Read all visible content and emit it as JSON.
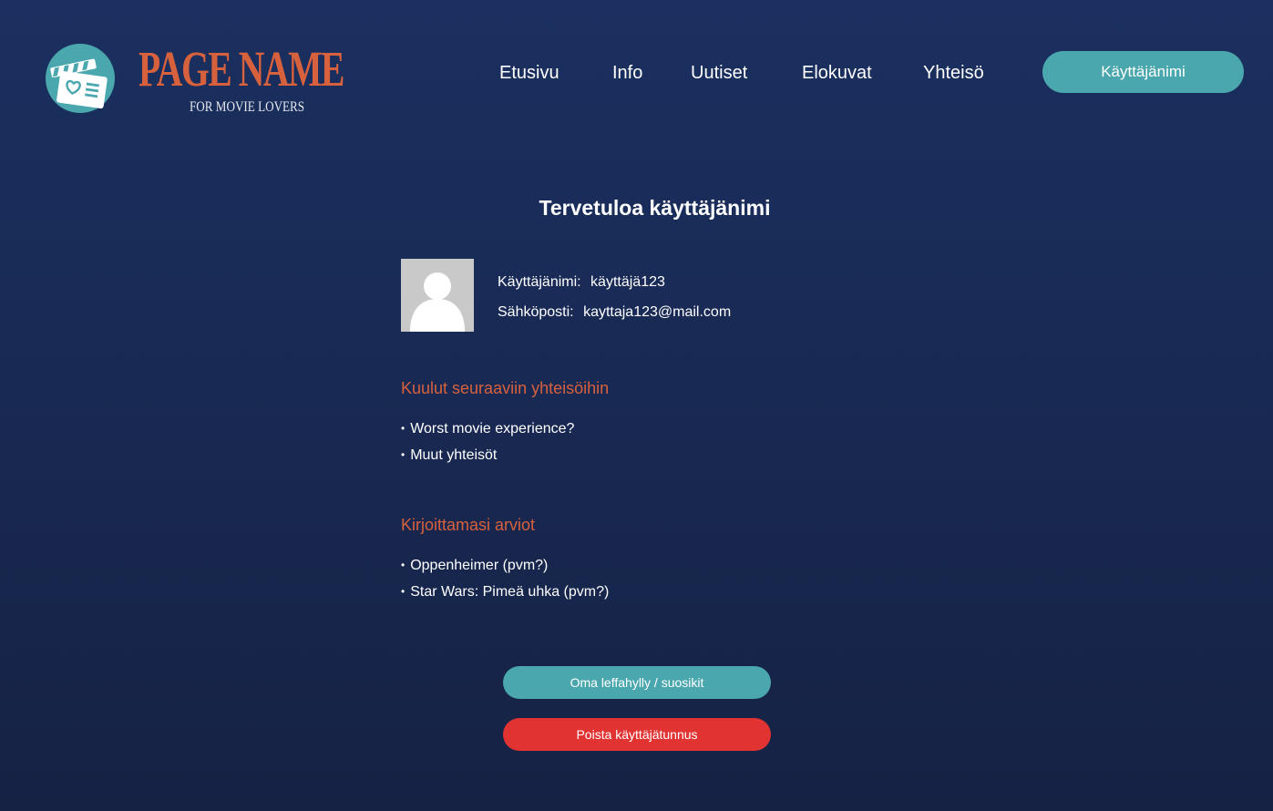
{
  "brand": {
    "name": "PAGE NAME",
    "tagline": "FOR MOVIE LOVERS",
    "icon": "clapperboard-icon",
    "color": "#d8613d"
  },
  "nav": {
    "items": [
      {
        "label": "Etusivu"
      },
      {
        "label": "Info"
      },
      {
        "label": "Uutiset"
      },
      {
        "label": "Elokuvat"
      },
      {
        "label": "Yhteisö"
      }
    ],
    "user_button": "Käyttäjänimi"
  },
  "profile": {
    "title": "Tervetuloa käyttäjänimi",
    "avatar_icon": "user-avatar-icon",
    "username_label": "Käyttäjänimi:",
    "username_value": "käyttäjä123",
    "email_label": "Sähköposti:",
    "email_value": "kayttaja123@mail.com"
  },
  "communities": {
    "heading": "Kuulut seuraaviin yhteisöihin",
    "items": [
      "Worst movie experience?",
      "Muut yhteisöt"
    ]
  },
  "reviews": {
    "heading": "Kirjoittamasi arviot",
    "items": [
      "Oppenheimer (pvm?)",
      "Star Wars: Pimeä uhka (pvm?)"
    ]
  },
  "actions": {
    "favorites": "Oma leffahylly / suosikit",
    "delete_account": "Poista käyttäjätunnus"
  },
  "colors": {
    "accent": "#d8613d",
    "teal": "#4aa7ae",
    "danger": "#e23333",
    "background": "#1b2d59"
  }
}
